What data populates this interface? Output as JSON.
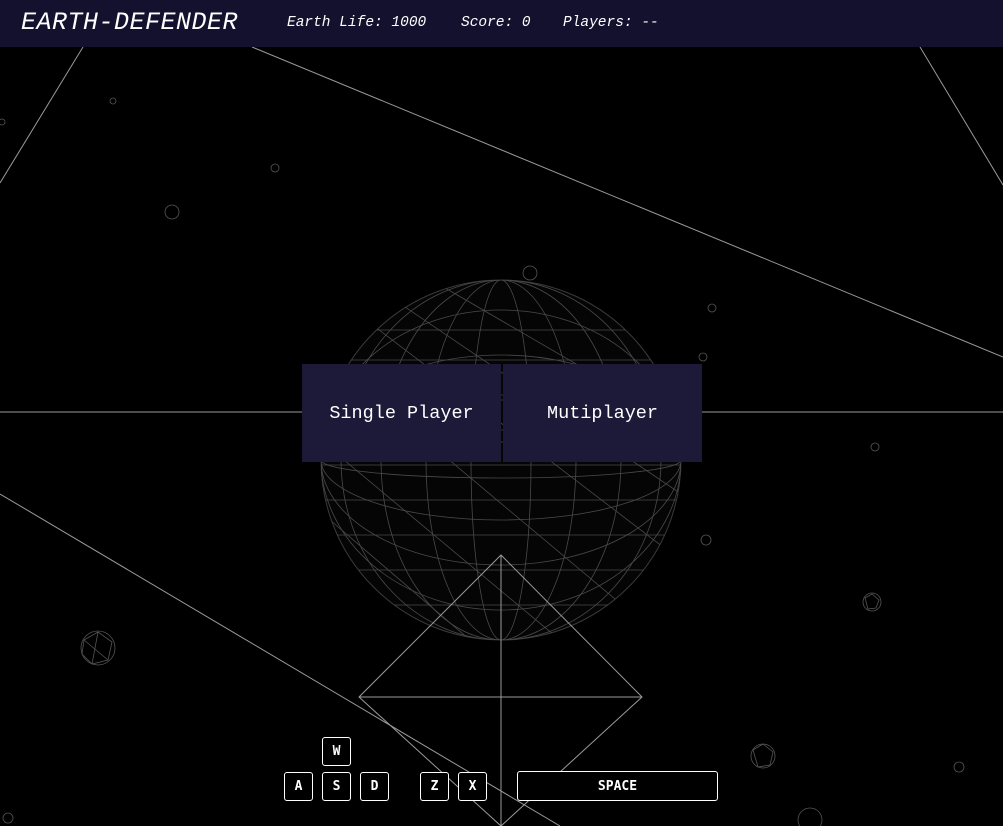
{
  "header": {
    "title": "EARTH-DEFENDER",
    "earth_life": "Earth Life: 1000",
    "score": "Score: 0",
    "players": "Players: --"
  },
  "menu": {
    "single_player_label": "Single Player",
    "multiplayer_label": "Mutiplayer"
  },
  "controls": {
    "keys": [
      "W",
      "A",
      "S",
      "D",
      "Z",
      "X",
      "SPACE"
    ]
  },
  "colors": {
    "background": "#000000",
    "header_bg": "#13112e",
    "button_bg": "#1c1a38",
    "text": "#ffffff",
    "wireframe": "#8a8a8a"
  }
}
